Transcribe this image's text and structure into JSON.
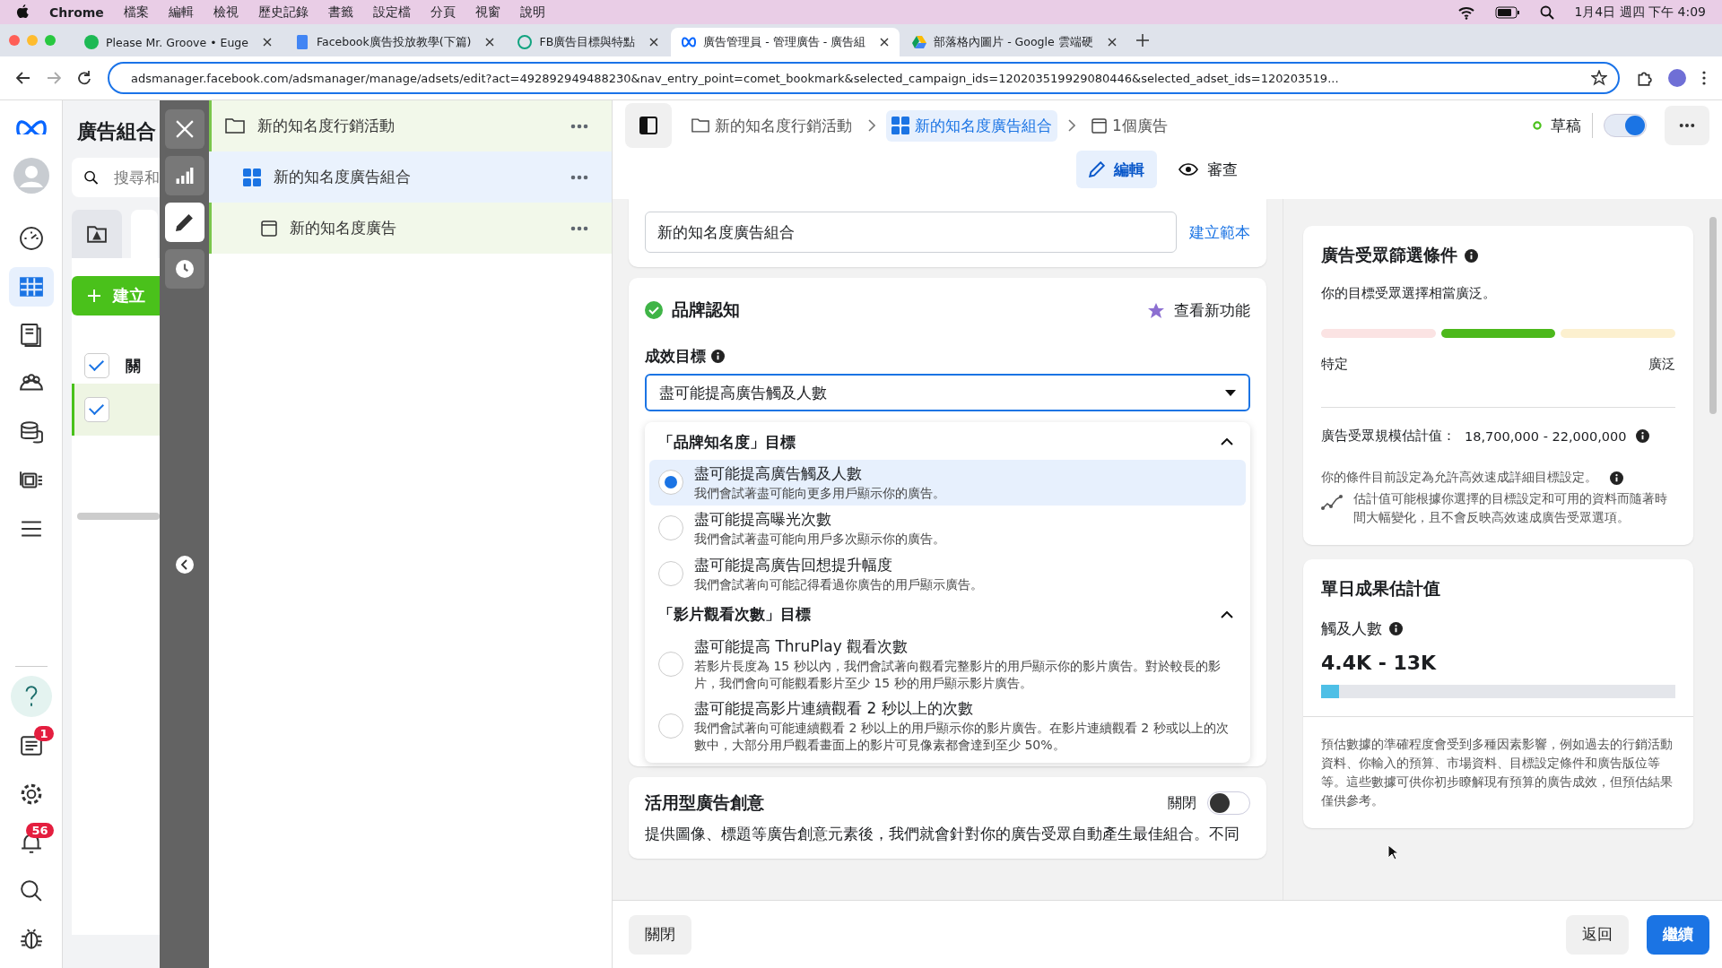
{
  "menubar": {
    "app": "Chrome",
    "menus": [
      "檔案",
      "編輯",
      "檢視",
      "歷史記錄",
      "書籤",
      "設定檔",
      "分頁",
      "視窗",
      "說明"
    ],
    "clock": "1月4日 週四 下午 4:09"
  },
  "tabs": [
    {
      "title": "Please Mr. Groove • Euge",
      "kind": "music",
      "selected": false
    },
    {
      "title": "Facebook廣告投放教學(下篇)",
      "kind": "doc",
      "selected": false
    },
    {
      "title": "FB廣告目標與特點",
      "kind": "knot",
      "selected": false
    },
    {
      "title": "廣告管理員 - 管理廣告 - 廣告組",
      "kind": "infinity",
      "selected": true
    },
    {
      "title": "部落格內圖片 - Google 雲端硬",
      "kind": "drive",
      "selected": false
    }
  ],
  "address_bar": {
    "url": "adsmanager.facebook.com/adsmanager/manage/adsets/edit?act=492892949488230&nav_entry_point=comet_bookmark&selected_campaign_ids=120203519929080446&selected_adset_ids=120203519..."
  },
  "nav_rail": [
    {
      "kind": "gauge",
      "selected": false
    },
    {
      "kind": "table",
      "selected": true
    },
    {
      "kind": "pages",
      "selected": false
    },
    {
      "kind": "people",
      "selected": false
    },
    {
      "kind": "coins",
      "selected": false
    },
    {
      "kind": "media",
      "selected": false
    },
    {
      "kind": "menu",
      "selected": false
    }
  ],
  "nav_rail_bottom": [
    {
      "kind": "help"
    },
    {
      "kind": "news",
      "badge": "1"
    },
    {
      "kind": "gear"
    },
    {
      "kind": "bell",
      "badge": "56"
    },
    {
      "kind": "search"
    },
    {
      "kind": "bug"
    }
  ],
  "left_panel": {
    "title": "廣告組合",
    "search_placeholder": "搜尋和",
    "create_button": "建立",
    "column_header": "關",
    "header_checked": true,
    "row_checked": true
  },
  "tool_column": [
    {
      "kind": "close",
      "selected": false
    },
    {
      "kind": "chart",
      "selected": false
    },
    {
      "kind": "pencil",
      "selected": true
    },
    {
      "kind": "clock",
      "selected": false
    }
  ],
  "tree": [
    {
      "label": "新的知名度行銷活動",
      "kind": "campaign",
      "selected": false
    },
    {
      "label": "新的知名度廣告組合",
      "kind": "adset",
      "selected": true
    },
    {
      "label": "新的知名度廣告",
      "kind": "ad",
      "selected": false
    }
  ],
  "breadcrumb": [
    {
      "label": "新的知名度行銷活動",
      "kind": "campaign",
      "selected": false
    },
    {
      "label": "新的知名度廣告組合",
      "kind": "adset",
      "selected": true
    },
    {
      "label": "1個廣告",
      "kind": "ad",
      "selected": false
    }
  ],
  "status": {
    "label": "草稿",
    "on": true
  },
  "mode_tabs": [
    {
      "label": "編輯",
      "kind": "edit",
      "selected": true
    },
    {
      "label": "審查",
      "kind": "review",
      "selected": false
    }
  ],
  "name_card": {
    "value": "新的知名度廣告組合",
    "link": "建立範本"
  },
  "objective_card": {
    "title": "品牌認知",
    "whats_new": "查看新功能",
    "goal_label": "成效目標",
    "goal_value": "盡可能提高廣告觸及人數",
    "groups": [
      {
        "title": "「品牌知名度」目標",
        "expanded": true,
        "options": [
          {
            "title": "盡可能提高廣告觸及人數",
            "description": "我們會試著盡可能向更多用戶顯示你的廣告。",
            "selected": true
          },
          {
            "title": "盡可能提高曝光次數",
            "description": "我們會試著盡可能向用戶多次顯示你的廣告。",
            "selected": false
          },
          {
            "title": "盡可能提高廣告回想提升幅度",
            "description": "我們會試著向可能記得看過你廣告的用戶顯示廣告。",
            "selected": false
          }
        ]
      },
      {
        "title": "「影片觀看次數」目標",
        "expanded": true,
        "options": [
          {
            "title": "盡可能提高 ThruPlay 觀看次數",
            "description": "若影片長度為 15 秒以內，我們會試著向觀看完整影片的用戶顯示你的影片廣告。對於較長的影片，我們會向可能觀看影片至少 15 秒的用戶顯示影片廣告。",
            "selected": false
          },
          {
            "title": "盡可能提高影片連續觀看 2 秒以上的次數",
            "description": "我們會試著向可能連續觀看 2 秒以上的用戶顯示你的影片廣告。在影片連續觀看 2 秒或以上的次數中，大部分用戶觀看畫面上的影片可見像素都會達到至少 50%。",
            "selected": false
          }
        ]
      }
    ]
  },
  "creative_card": {
    "title": "活用型廣告創意",
    "toggle_label": "關閉",
    "on": false,
    "description": "提供圖像、標題等廣告創意元素後，我們就會針對你的廣告受眾自動產生最佳組合。不同"
  },
  "audience_card": {
    "title": "廣告受眾篩選條件",
    "summary": "你的目標受眾選擇相當廣泛。",
    "segments": [
      {
        "selected": false
      },
      {
        "selected": true
      },
      {
        "selected": false
      }
    ],
    "low_label": "特定",
    "high_label": "廣泛",
    "size_label": "廣告受眾規模估計值：",
    "size_value": "18,700,000 - 22,000,000",
    "note1": "你的條件目前設定為允許高效速成詳細目標設定。",
    "note2": "估計值可能根據你選擇的目標設定和可用的資料而隨著時間大幅變化，且不會反映高效速成廣告受眾選項。"
  },
  "results_card": {
    "title": "單日成果估計值",
    "metric": "觸及人數",
    "range": "4.4K - 13K",
    "level": 0.05,
    "note": "預估數據的準確程度會受到多種因素影響，例如過去的行銷活動資料、你輸入的預算、市場資料、目標設定條件和廣告版位等等。這些數據可供你初步瞭解現有預算的廣告成效，但預估結果僅供參考。"
  },
  "footer": {
    "close": "關閉",
    "back": "返回",
    "continue": "繼續"
  }
}
